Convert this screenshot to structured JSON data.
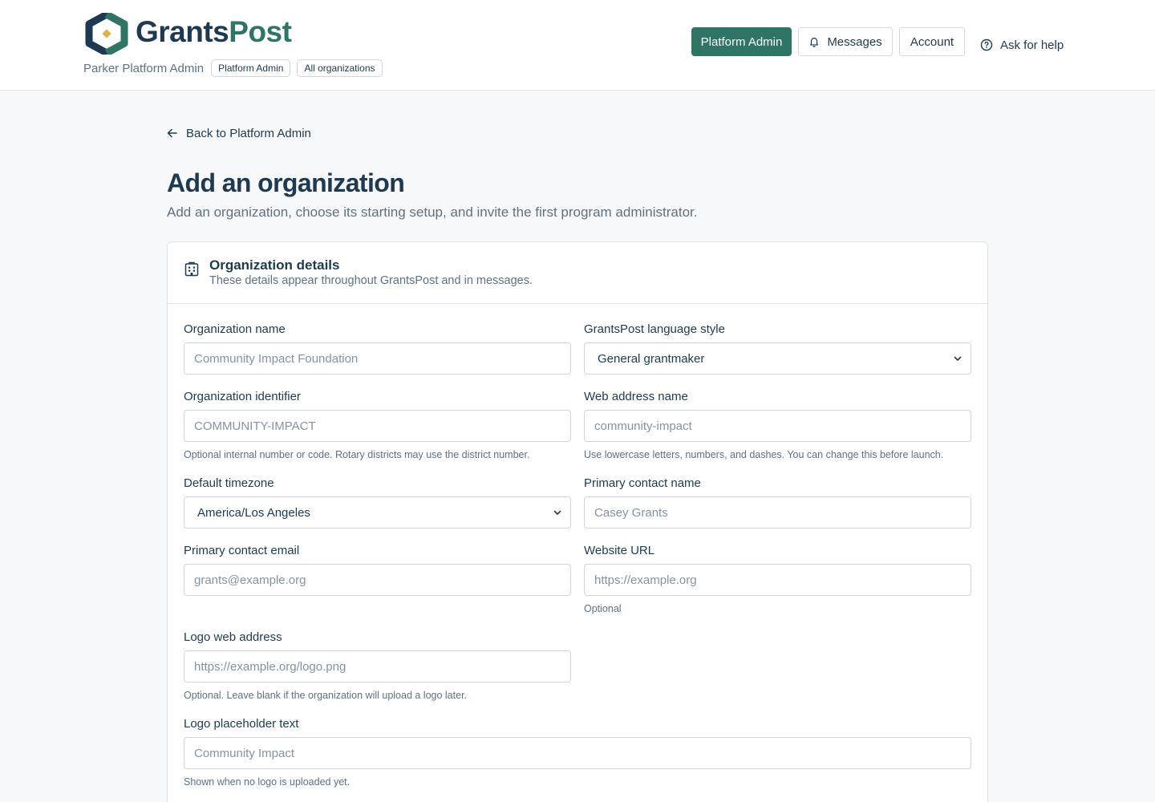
{
  "brand": {
    "part1": "Grants",
    "part2": "Post",
    "accent": "#2f7566",
    "navy": "#1d3a52"
  },
  "header": {
    "user_name": "Parker Platform Admin",
    "role_badge": "Platform Admin",
    "scope_badge": "All organizations",
    "nav": {
      "platform_admin": "Platform Admin",
      "messages": "Messages",
      "account": "Account",
      "help": "Ask for help"
    },
    "icons": {
      "messages": "bell-icon",
      "help": "help-circle-icon"
    }
  },
  "page": {
    "back_link": "Back to Platform Admin",
    "title": "Add an organization",
    "subtitle": "Add an organization, choose its starting setup, and invite the first program administrator."
  },
  "card": {
    "title": "Organization details",
    "description": "These details appear throughout GrantsPost and in messages.",
    "icon": "building-icon"
  },
  "form": {
    "org_name": {
      "label": "Organization name",
      "placeholder": "Community Impact Foundation",
      "value": ""
    },
    "language_style": {
      "label": "GrantsPost language style",
      "value": "General grantmaker"
    },
    "org_identifier": {
      "label": "Organization identifier",
      "placeholder": "COMMUNITY-IMPACT",
      "value": "",
      "hint": "Optional internal number or code. Rotary districts may use the district number."
    },
    "web_address_name": {
      "label": "Web address name",
      "placeholder": "community-impact",
      "value": "",
      "hint": "Use lowercase letters, numbers, and dashes. You can change this before launch."
    },
    "timezone": {
      "label": "Default timezone",
      "value": "America/Los Angeles"
    },
    "contact_name": {
      "label": "Primary contact name",
      "placeholder": "Casey Grants",
      "value": ""
    },
    "contact_email": {
      "label": "Primary contact email",
      "placeholder": "grants@example.org",
      "value": ""
    },
    "website_url": {
      "label": "Website URL",
      "placeholder": "https://example.org",
      "value": "",
      "hint": "Optional"
    },
    "logo_url": {
      "label": "Logo web address",
      "placeholder": "https://example.org/logo.png",
      "value": "",
      "hint": "Optional. Leave blank if the organization will upload a logo later."
    },
    "logo_text": {
      "label": "Logo placeholder text",
      "placeholder": "Community Impact",
      "value": "",
      "hint": "Shown when no logo is uploaded yet."
    }
  }
}
